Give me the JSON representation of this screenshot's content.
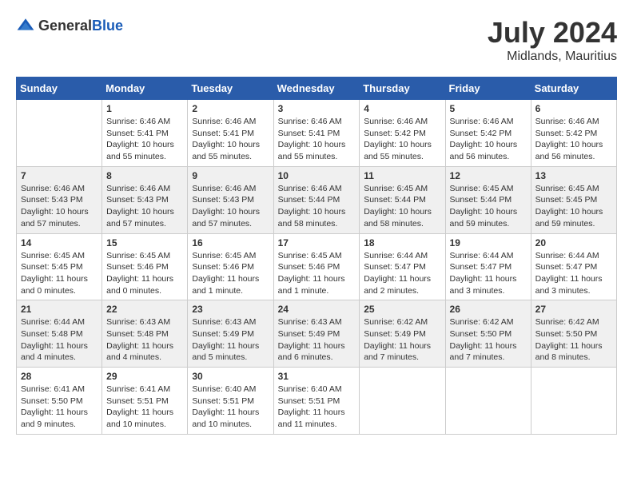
{
  "logo": {
    "text_general": "General",
    "text_blue": "Blue"
  },
  "title": {
    "month_year": "July 2024",
    "location": "Midlands, Mauritius"
  },
  "weekdays": [
    "Sunday",
    "Monday",
    "Tuesday",
    "Wednesday",
    "Thursday",
    "Friday",
    "Saturday"
  ],
  "weeks": [
    [
      {
        "day": "",
        "info": ""
      },
      {
        "day": "1",
        "info": "Sunrise: 6:46 AM\nSunset: 5:41 PM\nDaylight: 10 hours\nand 55 minutes."
      },
      {
        "day": "2",
        "info": "Sunrise: 6:46 AM\nSunset: 5:41 PM\nDaylight: 10 hours\nand 55 minutes."
      },
      {
        "day": "3",
        "info": "Sunrise: 6:46 AM\nSunset: 5:41 PM\nDaylight: 10 hours\nand 55 minutes."
      },
      {
        "day": "4",
        "info": "Sunrise: 6:46 AM\nSunset: 5:42 PM\nDaylight: 10 hours\nand 55 minutes."
      },
      {
        "day": "5",
        "info": "Sunrise: 6:46 AM\nSunset: 5:42 PM\nDaylight: 10 hours\nand 56 minutes."
      },
      {
        "day": "6",
        "info": "Sunrise: 6:46 AM\nSunset: 5:42 PM\nDaylight: 10 hours\nand 56 minutes."
      }
    ],
    [
      {
        "day": "7",
        "info": "Sunrise: 6:46 AM\nSunset: 5:43 PM\nDaylight: 10 hours\nand 57 minutes."
      },
      {
        "day": "8",
        "info": "Sunrise: 6:46 AM\nSunset: 5:43 PM\nDaylight: 10 hours\nand 57 minutes."
      },
      {
        "day": "9",
        "info": "Sunrise: 6:46 AM\nSunset: 5:43 PM\nDaylight: 10 hours\nand 57 minutes."
      },
      {
        "day": "10",
        "info": "Sunrise: 6:46 AM\nSunset: 5:44 PM\nDaylight: 10 hours\nand 58 minutes."
      },
      {
        "day": "11",
        "info": "Sunrise: 6:45 AM\nSunset: 5:44 PM\nDaylight: 10 hours\nand 58 minutes."
      },
      {
        "day": "12",
        "info": "Sunrise: 6:45 AM\nSunset: 5:44 PM\nDaylight: 10 hours\nand 59 minutes."
      },
      {
        "day": "13",
        "info": "Sunrise: 6:45 AM\nSunset: 5:45 PM\nDaylight: 10 hours\nand 59 minutes."
      }
    ],
    [
      {
        "day": "14",
        "info": "Sunrise: 6:45 AM\nSunset: 5:45 PM\nDaylight: 11 hours\nand 0 minutes."
      },
      {
        "day": "15",
        "info": "Sunrise: 6:45 AM\nSunset: 5:46 PM\nDaylight: 11 hours\nand 0 minutes."
      },
      {
        "day": "16",
        "info": "Sunrise: 6:45 AM\nSunset: 5:46 PM\nDaylight: 11 hours\nand 1 minute."
      },
      {
        "day": "17",
        "info": "Sunrise: 6:45 AM\nSunset: 5:46 PM\nDaylight: 11 hours\nand 1 minute."
      },
      {
        "day": "18",
        "info": "Sunrise: 6:44 AM\nSunset: 5:47 PM\nDaylight: 11 hours\nand 2 minutes."
      },
      {
        "day": "19",
        "info": "Sunrise: 6:44 AM\nSunset: 5:47 PM\nDaylight: 11 hours\nand 3 minutes."
      },
      {
        "day": "20",
        "info": "Sunrise: 6:44 AM\nSunset: 5:47 PM\nDaylight: 11 hours\nand 3 minutes."
      }
    ],
    [
      {
        "day": "21",
        "info": "Sunrise: 6:44 AM\nSunset: 5:48 PM\nDaylight: 11 hours\nand 4 minutes."
      },
      {
        "day": "22",
        "info": "Sunrise: 6:43 AM\nSunset: 5:48 PM\nDaylight: 11 hours\nand 4 minutes."
      },
      {
        "day": "23",
        "info": "Sunrise: 6:43 AM\nSunset: 5:49 PM\nDaylight: 11 hours\nand 5 minutes."
      },
      {
        "day": "24",
        "info": "Sunrise: 6:43 AM\nSunset: 5:49 PM\nDaylight: 11 hours\nand 6 minutes."
      },
      {
        "day": "25",
        "info": "Sunrise: 6:42 AM\nSunset: 5:49 PM\nDaylight: 11 hours\nand 7 minutes."
      },
      {
        "day": "26",
        "info": "Sunrise: 6:42 AM\nSunset: 5:50 PM\nDaylight: 11 hours\nand 7 minutes."
      },
      {
        "day": "27",
        "info": "Sunrise: 6:42 AM\nSunset: 5:50 PM\nDaylight: 11 hours\nand 8 minutes."
      }
    ],
    [
      {
        "day": "28",
        "info": "Sunrise: 6:41 AM\nSunset: 5:50 PM\nDaylight: 11 hours\nand 9 minutes."
      },
      {
        "day": "29",
        "info": "Sunrise: 6:41 AM\nSunset: 5:51 PM\nDaylight: 11 hours\nand 10 minutes."
      },
      {
        "day": "30",
        "info": "Sunrise: 6:40 AM\nSunset: 5:51 PM\nDaylight: 11 hours\nand 10 minutes."
      },
      {
        "day": "31",
        "info": "Sunrise: 6:40 AM\nSunset: 5:51 PM\nDaylight: 11 hours\nand 11 minutes."
      },
      {
        "day": "",
        "info": ""
      },
      {
        "day": "",
        "info": ""
      },
      {
        "day": "",
        "info": ""
      }
    ]
  ]
}
